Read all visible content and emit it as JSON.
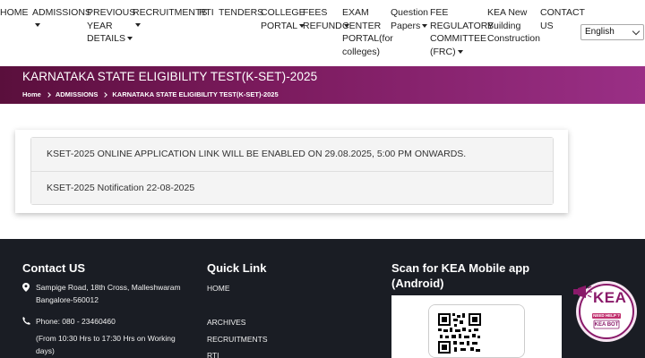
{
  "nav": {
    "items": [
      {
        "lines": [
          "HOME"
        ],
        "dropdown": false
      },
      {
        "lines": [
          "ADMISSIONS"
        ],
        "dropdown": true
      },
      {
        "lines": [
          "PREVIOUS",
          "YEAR",
          "DETAILS"
        ],
        "dropdown": true
      },
      {
        "lines": [
          "RECRUITMENTS"
        ],
        "dropdown": true
      },
      {
        "lines": [
          "RTI"
        ],
        "dropdown": false
      },
      {
        "lines": [
          "TENDERS"
        ],
        "dropdown": false
      },
      {
        "lines": [
          "COLLEGE",
          "PORTAL"
        ],
        "dropdown": true
      },
      {
        "lines": [
          "FEES",
          "REFUND"
        ],
        "dropdown": true
      },
      {
        "lines": [
          "EXAM",
          "CENTER",
          "PORTAL(for",
          "colleges)"
        ],
        "dropdown": false
      },
      {
        "lines": [
          "Question",
          "Papers"
        ],
        "dropdown": true
      },
      {
        "lines": [
          "FEE",
          "REGULATORY",
          "COMMITTEE",
          "(FRC)"
        ],
        "dropdown": true
      },
      {
        "lines": [
          "KEA New",
          "Building",
          "Construction"
        ],
        "dropdown": false
      },
      {
        "lines": [
          "CONTACT",
          "US"
        ],
        "dropdown": false
      }
    ],
    "language": "English"
  },
  "banner": {
    "title": "KARNATAKA STATE ELIGIBILITY TEST(K-SET)-2025",
    "breadcrumb": [
      "Home",
      "ADMISSIONS",
      "KARNATAKA STATE ELIGIBILITY TEST(K-SET)-2025"
    ]
  },
  "content": {
    "items": [
      "KSET-2025 ONLINE APPLICATION LINK WILL BE ENABLED ON 29.08.2025, 5:00 PM ONWARDS.",
      "KSET-2025 Notification 22-08-2025"
    ]
  },
  "footer": {
    "contact": {
      "heading": "Contact US",
      "address": [
        "Sampige Road, 18th Cross, Malleshwaram",
        "Bangalore-560012"
      ],
      "phone": "Phone: 080 - 23460460",
      "hours": [
        "(From 10:30 Hrs to 17:30 Hrs on Working",
        "days)"
      ]
    },
    "quick_links": {
      "heading": "Quick Link",
      "items": [
        "HOME",
        "ARCHIVES",
        "RECRUITMENTS",
        "RTI"
      ]
    },
    "app": {
      "heading": [
        "Scan for KEA Mobile app",
        "(Android)"
      ]
    }
  },
  "bot": {
    "logo_text": "KEA",
    "tag": "NEED HELP ?",
    "name": "KEA BOT"
  },
  "colors": {
    "banner_start": "#5a0f3c",
    "banner_end": "#9a2f86",
    "footer_bg": "#1a1d24",
    "bot_accent": "#8a1a6a"
  }
}
